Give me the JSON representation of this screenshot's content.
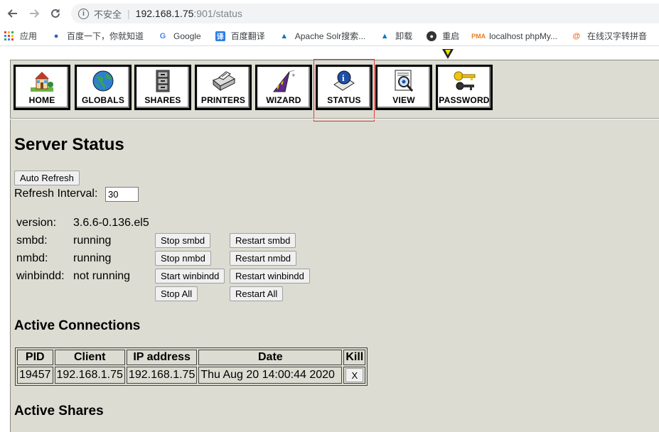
{
  "browser": {
    "back_icon": "arrow-left-icon",
    "forward_icon": "arrow-right-icon",
    "reload_icon": "reload-icon",
    "insecure_label": "不安全",
    "url_host": "192.168.1.75",
    "url_rest": ":901/status"
  },
  "bookmarks": [
    {
      "label": "应用",
      "icon": "apps-grid-icon"
    },
    {
      "label": "百度一下，你就知道",
      "icon": "baidu-paw-icon"
    },
    {
      "label": "Google",
      "icon": "google-icon"
    },
    {
      "label": "百度翻译",
      "icon": "translate-icon"
    },
    {
      "label": "Apache Solr搜索...",
      "icon": "drupal-drop-icon"
    },
    {
      "label": "卸载",
      "icon": "drupal-drop-icon"
    },
    {
      "label": "重启",
      "icon": "github-icon"
    },
    {
      "label": "localhost phpMy...",
      "icon": "phpmyadmin-icon"
    },
    {
      "label": "在线汉字转拼音",
      "icon": "spiral-icon"
    }
  ],
  "toolbar": {
    "items": [
      {
        "label": "HOME",
        "icon": "house-icon"
      },
      {
        "label": "GLOBALS",
        "icon": "globe-icon"
      },
      {
        "label": "SHARES",
        "icon": "file-cabinet-icon"
      },
      {
        "label": "PRINTERS",
        "icon": "printer-icon"
      },
      {
        "label": "WIZARD",
        "icon": "wizard-hat-icon"
      },
      {
        "label": "STATUS",
        "icon": "info-icon"
      },
      {
        "label": "VIEW",
        "icon": "magnifier-icon"
      },
      {
        "label": "PASSWORD",
        "icon": "keys-icon"
      }
    ]
  },
  "page": {
    "title": "Server Status",
    "auto_refresh_label": "Auto Refresh",
    "refresh_interval_label": "Refresh Interval:",
    "refresh_interval_value": "30",
    "version_label": "version:",
    "version_value": "3.6.6-0.136.el5",
    "daemons": [
      {
        "name": "smbd:",
        "state": "running",
        "stop": "Stop smbd",
        "restart": "Restart smbd"
      },
      {
        "name": "nmbd:",
        "state": "running",
        "stop": "Stop nmbd",
        "restart": "Restart nmbd"
      },
      {
        "name": "winbindd:",
        "state": "not running",
        "stop": "Start winbindd",
        "restart": "Restart winbindd"
      }
    ],
    "stop_all": "Stop All",
    "restart_all": "Restart All",
    "active_connections_title": "Active Connections",
    "connections_headers": [
      "PID",
      "Client",
      "IP address",
      "Date",
      "Kill"
    ],
    "connections": [
      {
        "pid": "19457",
        "client": "192.168.1.75",
        "ip": "192.168.1.75",
        "date": "Thu Aug 20 14:00:44 2020",
        "kill": "X"
      }
    ],
    "active_shares_title": "Active Shares"
  }
}
